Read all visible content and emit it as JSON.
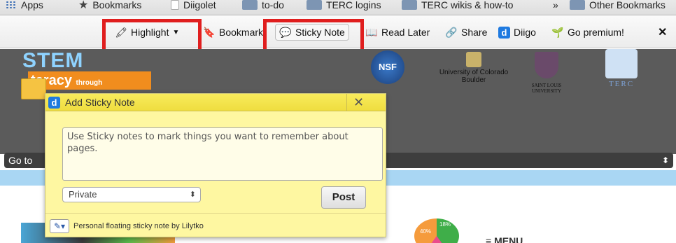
{
  "bookmarks_bar": {
    "items": [
      {
        "label": "Apps",
        "icon": "apps-grid-icon"
      },
      {
        "label": "Bookmarks",
        "icon": "star-icon"
      },
      {
        "label": "Diigolet",
        "icon": "page-icon"
      },
      {
        "label": "to-do",
        "icon": "folder-icon"
      },
      {
        "label": "TERC logins",
        "icon": "folder-icon"
      },
      {
        "label": "TERC wikis & how-to",
        "icon": "folder-icon"
      },
      {
        "label": "»",
        "icon": ""
      },
      {
        "label": "Other Bookmarks",
        "icon": "folder-icon"
      }
    ]
  },
  "toolbar": {
    "highlight_label": "Highlight",
    "bookmark_label": "Bookmark",
    "sticky_label": "Sticky Note",
    "read_later_label": "Read Later",
    "share_label": "Share",
    "diigo_label": "Diigo",
    "premium_label": "Go premium!",
    "close_label": "✕",
    "accent": "#e01e1e"
  },
  "page": {
    "logo_stem": "STEM",
    "logo_literacy": "teracy",
    "logo_through": "through",
    "nsf_label": "NSF",
    "cu_label": "University of Colorado Boulder",
    "slu_label": "SAINT LOUIS UNIVERSITY",
    "terc_label": "TERC",
    "goto_label": "Go to",
    "menu_label": "MENU",
    "pie_label_40": "40%",
    "pie_label_18": "18%"
  },
  "sticky": {
    "title": "Add Sticky Note",
    "close": "✕",
    "textarea_value": "Use Sticky notes to mark things you want to remember about pages.",
    "privacy_selected": "Private",
    "post_label": "Post",
    "footer_text": "Personal floating sticky note by Lilytko",
    "bg_color": "#fef7a1",
    "header_color": "#f3e34a"
  }
}
